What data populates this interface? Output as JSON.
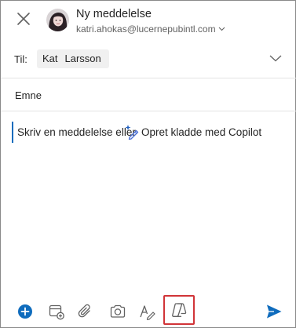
{
  "header": {
    "title": "Ny meddelelse",
    "sender_email": "katri.ahokas@lucernepubintl.com"
  },
  "to_field": {
    "label": "Til:",
    "recipient_first": "Kat",
    "recipient_last": "Larsson"
  },
  "subject": {
    "placeholder": "Emne"
  },
  "body": {
    "placeholder": "Skriv en meddelelse eller",
    "copilot_link": "Opret kladde med Copilot"
  },
  "toolbar": {
    "icons": [
      "add-icon",
      "calendar-add-icon",
      "attach-icon",
      "camera-icon",
      "pen-icon",
      "copilot-icon",
      "send-icon"
    ]
  },
  "colors": {
    "accent": "#0f6cbd",
    "highlight_border": "#d13438"
  }
}
